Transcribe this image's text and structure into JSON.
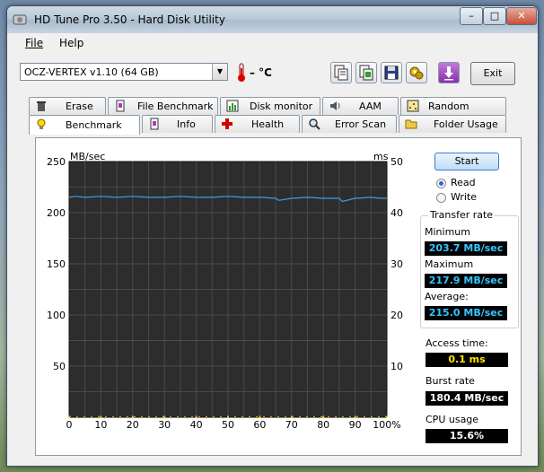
{
  "window": {
    "title": "HD Tune Pro 3.50 - Hard Disk Utility"
  },
  "menu": {
    "file": "File",
    "help": "Help"
  },
  "toolbar": {
    "drive": "OCZ-VERTEX v1.10 (64 GB)",
    "temperature": "– °C",
    "exit_label": "Exit",
    "icons": [
      "copy-text-icon",
      "copy-screen-icon",
      "save-icon",
      "options-icon",
      "download-icon"
    ]
  },
  "tabs_top": [
    "Erase",
    "File Benchmark",
    "Disk monitor",
    "AAM",
    "Random Access"
  ],
  "tabs_bottom": [
    "Benchmark",
    "Info",
    "Health",
    "Error Scan",
    "Folder Usage"
  ],
  "benchmark": {
    "start_label": "Start",
    "read_label": "Read",
    "write_label": "Write",
    "mode_selected": "Read",
    "transfer_rate_title": "Transfer rate",
    "minimum_label": "Minimum",
    "minimum_value": "203.7 MB/sec",
    "maximum_label": "Maximum",
    "maximum_value": "217.9 MB/sec",
    "average_label": "Average:",
    "average_value": "215.0 MB/sec",
    "access_time_label": "Access time:",
    "access_time_value": "0.1 ms",
    "burst_rate_label": "Burst rate",
    "burst_rate_value": "180.4 MB/sec",
    "cpu_usage_label": "CPU usage",
    "cpu_usage_value": "15.6%"
  },
  "chart_data": {
    "type": "line",
    "ylabel": "MB/sec",
    "y2label": "ms",
    "ylim": [
      0,
      250
    ],
    "y2lim": [
      0,
      50
    ],
    "yticks": [
      "250",
      "200",
      "150",
      "100",
      "50"
    ],
    "y2ticks": [
      "50",
      "40",
      "30",
      "20",
      "10"
    ],
    "xticks": [
      "0",
      "10",
      "20",
      "30",
      "40",
      "50",
      "60",
      "70",
      "80",
      "90",
      "100%"
    ],
    "grid": true,
    "series": [
      {
        "color": "#3aa0e8",
        "x": [
          0,
          2,
          5,
          10,
          15,
          20,
          25,
          30,
          35,
          40,
          45,
          50,
          55,
          60,
          65,
          66,
          70,
          75,
          80,
          85,
          86,
          90,
          95,
          98,
          100
        ],
        "y": [
          215,
          216,
          215,
          216,
          215,
          216,
          215,
          215,
          216,
          215,
          215,
          216,
          215,
          215,
          214,
          212,
          214,
          215,
          214,
          214,
          211,
          214,
          215,
          214,
          214
        ]
      },
      {
        "color": "#f0c000",
        "x": [
          0,
          10,
          20,
          30,
          40,
          50,
          60,
          70,
          80,
          90,
          100
        ],
        "y2": [
          0.1,
          0.1,
          0.1,
          0.1,
          0.1,
          0.1,
          0.1,
          0.1,
          0.1,
          0.1,
          0.1
        ]
      }
    ]
  }
}
